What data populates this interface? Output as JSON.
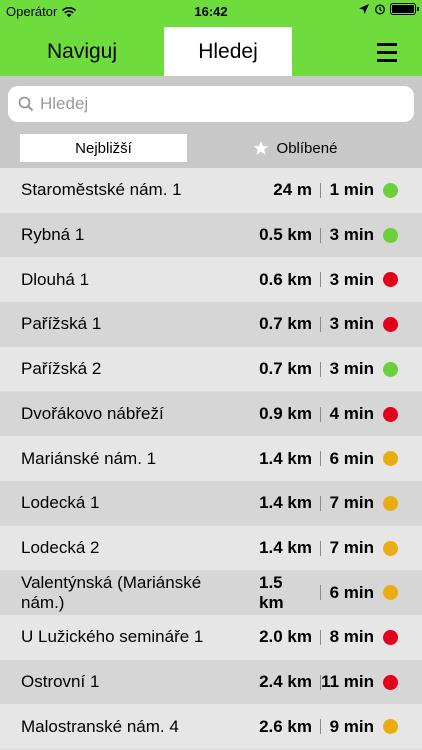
{
  "status_bar": {
    "carrier": "Operátor",
    "time": "16:42"
  },
  "header": {
    "tabs": [
      {
        "label": "Naviguj",
        "active": false
      },
      {
        "label": "Hledej",
        "active": true
      }
    ],
    "menu_icon": "hamburger-menu-icon",
    "color": "#6fdc3e"
  },
  "search": {
    "placeholder": "Hledej",
    "value": ""
  },
  "segments": {
    "nearest_label": "Nejbližší",
    "favorites_label": "Oblíbené",
    "selected": "nearest"
  },
  "status_colors": {
    "green": "#6ccf3c",
    "red": "#e3001b",
    "yellow": "#e9ad12"
  },
  "stops": [
    {
      "name": "Staroměstské nám. 1",
      "distance": "24 m",
      "time": "1 min",
      "status": "green"
    },
    {
      "name": "Rybná 1",
      "distance": "0.5 km",
      "time": "3 min",
      "status": "green"
    },
    {
      "name": "Dlouhá 1",
      "distance": "0.6 km",
      "time": "3 min",
      "status": "red"
    },
    {
      "name": "Pařížská 1",
      "distance": "0.7 km",
      "time": "3 min",
      "status": "red"
    },
    {
      "name": "Pařížská 2",
      "distance": "0.7 km",
      "time": "3 min",
      "status": "green"
    },
    {
      "name": "Dvořákovo nábřeží",
      "distance": "0.9 km",
      "time": "4 min",
      "status": "red"
    },
    {
      "name": "Mariánské nám. 1",
      "distance": "1.4 km",
      "time": "6 min",
      "status": "yellow"
    },
    {
      "name": "Lodecká 1",
      "distance": "1.4 km",
      "time": "7 min",
      "status": "yellow"
    },
    {
      "name": "Lodecká 2",
      "distance": "1.4 km",
      "time": "7 min",
      "status": "yellow"
    },
    {
      "name": "Valentýnská (Mariánské nám.)",
      "distance": "1.5 km",
      "time": "6 min",
      "status": "yellow"
    },
    {
      "name": "U Lužického semináře 1",
      "distance": "2.0 km",
      "time": "8 min",
      "status": "red"
    },
    {
      "name": "Ostrovní 1",
      "distance": "2.4 km",
      "time": "11 min",
      "status": "red"
    },
    {
      "name": "Malostranské nám. 4",
      "distance": "2.6 km",
      "time": "9 min",
      "status": "yellow"
    }
  ]
}
